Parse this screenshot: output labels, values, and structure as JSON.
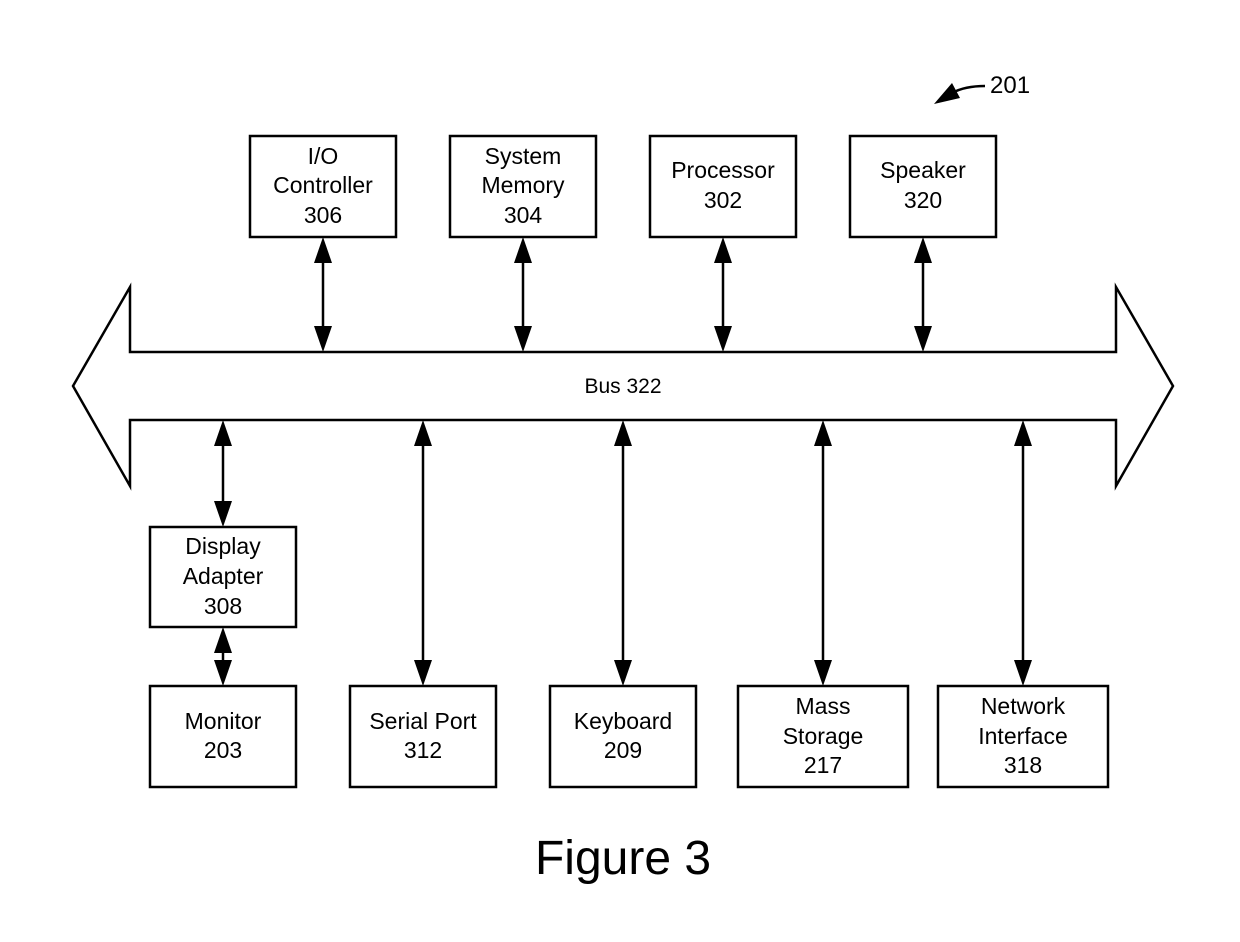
{
  "figure": {
    "caption": "Figure 3",
    "reference_label": "201"
  },
  "bus": {
    "label": "Bus 322"
  },
  "components_top": [
    {
      "id": "io-controller",
      "lines": [
        "I/O",
        "Controller",
        "306"
      ]
    },
    {
      "id": "system-memory",
      "lines": [
        "System",
        "Memory",
        "304"
      ]
    },
    {
      "id": "processor",
      "lines": [
        "Processor",
        "302"
      ]
    },
    {
      "id": "speaker",
      "lines": [
        "Speaker",
        "320"
      ]
    }
  ],
  "components_bottom": [
    {
      "id": "display-adapter",
      "lines": [
        "Display",
        "Adapter",
        "308"
      ]
    },
    {
      "id": "monitor",
      "lines": [
        "Monitor",
        "203"
      ]
    },
    {
      "id": "serial-port",
      "lines": [
        "Serial Port",
        "312"
      ]
    },
    {
      "id": "keyboard",
      "lines": [
        "Keyboard",
        "209"
      ]
    },
    {
      "id": "mass-storage",
      "lines": [
        "Mass",
        "Storage",
        "217"
      ]
    },
    {
      "id": "network-interface",
      "lines": [
        "Network",
        "Interface",
        "318"
      ]
    }
  ],
  "connections": [
    {
      "from": "io-controller",
      "to": "bus",
      "type": "bidirectional"
    },
    {
      "from": "system-memory",
      "to": "bus",
      "type": "bidirectional"
    },
    {
      "from": "processor",
      "to": "bus",
      "type": "bidirectional"
    },
    {
      "from": "speaker",
      "to": "bus",
      "type": "bidirectional"
    },
    {
      "from": "bus",
      "to": "display-adapter",
      "type": "bidirectional"
    },
    {
      "from": "display-adapter",
      "to": "monitor",
      "type": "bidirectional"
    },
    {
      "from": "bus",
      "to": "serial-port",
      "type": "bidirectional"
    },
    {
      "from": "bus",
      "to": "keyboard",
      "type": "bidirectional"
    },
    {
      "from": "bus",
      "to": "mass-storage",
      "type": "bidirectional"
    },
    {
      "from": "bus",
      "to": "network-interface",
      "type": "bidirectional"
    }
  ]
}
